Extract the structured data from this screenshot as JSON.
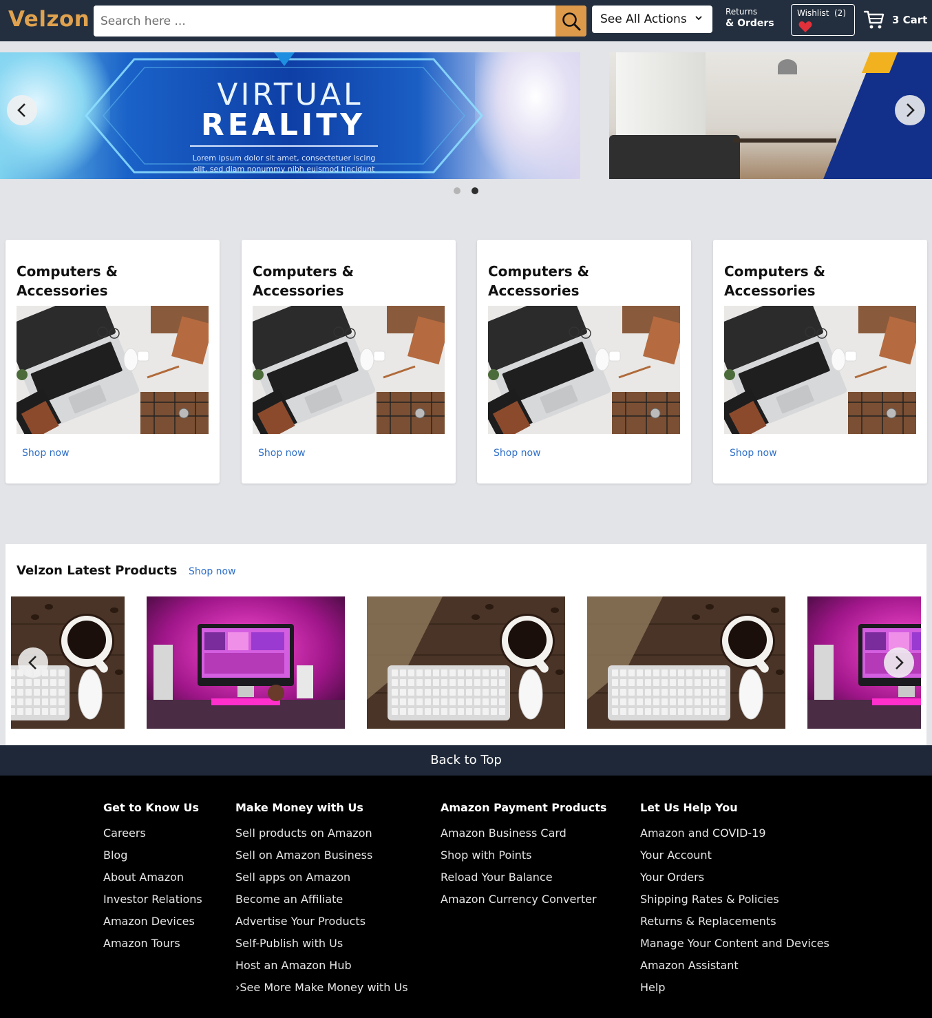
{
  "header": {
    "logo": "Velzon",
    "search_placeholder": "Search here ...",
    "actions_label": "See All Actions",
    "returns_line1": "Returns",
    "returns_line2": "& Orders",
    "wishlist_label": "Wishlist",
    "wishlist_count": "(2)",
    "cart_label": "3 Cart",
    "accent": "#e0a24e",
    "bg": "#232f3e"
  },
  "hero": {
    "title_line1": "VIRTUAL",
    "title_line2": "REALITY",
    "body_text": "Lorem ipsum dolor sit amet, consectetuer iscing elit, sed diam nonummy nibh euismod tincidunt",
    "dots": [
      {
        "active": false
      },
      {
        "active": true
      }
    ]
  },
  "categories": [
    {
      "title": "Computers & Accessories",
      "link": "Shop now"
    },
    {
      "title": "Computers & Accessories",
      "link": "Shop now"
    },
    {
      "title": "Computers & Accessories",
      "link": "Shop now"
    },
    {
      "title": "Computers & Accessories",
      "link": "Shop now"
    }
  ],
  "latest": {
    "title": "Velzon Latest Products",
    "link": "Shop now",
    "products": [
      {
        "kind": "coffee-keyboard"
      },
      {
        "kind": "pink-desktop"
      },
      {
        "kind": "coffee-keyboard"
      },
      {
        "kind": "coffee-keyboard"
      },
      {
        "kind": "pink-desktop"
      }
    ]
  },
  "footer": {
    "back_to_top": "Back to Top",
    "columns": [
      {
        "heading": "Get to Know Us",
        "links": [
          "Careers",
          "Blog",
          "About Amazon",
          "Investor Relations",
          "Amazon Devices",
          "Amazon Tours"
        ]
      },
      {
        "heading": "Make Money with Us",
        "links": [
          "Sell products on Amazon",
          "Sell on Amazon Business",
          "Sell apps on Amazon",
          "Become an Affiliate",
          "Advertise Your Products",
          "Self-Publish with Us",
          "Host an Amazon Hub",
          "›See More Make Money with Us"
        ]
      },
      {
        "heading": "Amazon Payment Products",
        "links": [
          "Amazon Business Card",
          "Shop with Points",
          "Reload Your Balance",
          "Amazon Currency Converter"
        ]
      },
      {
        "heading": "Let Us Help You",
        "links": [
          "Amazon and COVID-19",
          "Your Account",
          "Your Orders",
          "Shipping Rates & Policies",
          "Returns & Replacements",
          "Manage Your Content and Devices",
          "Amazon Assistant",
          "Help"
        ]
      }
    ]
  }
}
